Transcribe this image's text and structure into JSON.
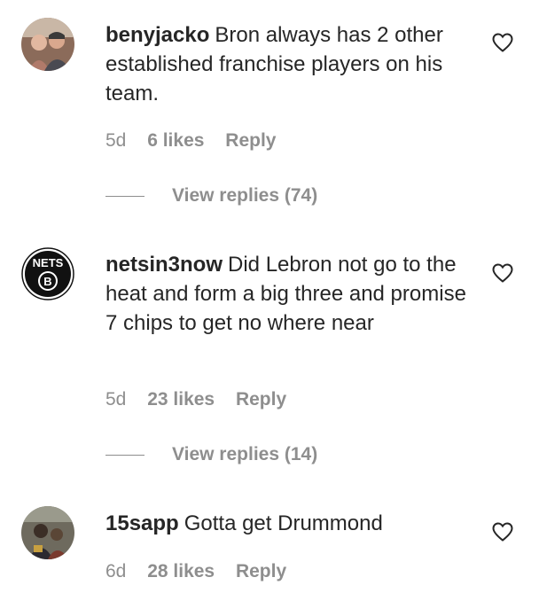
{
  "comments": [
    {
      "username": "benyjacko",
      "text": "Bron always has 2 other established franchise players on his team.",
      "age": "5d",
      "likes": "6 likes",
      "reply": "Reply",
      "view_replies": "View replies (74)"
    },
    {
      "username": "netsin3now",
      "text": "Did Lebron not go to the heat and form a big three and promise 7 chips to get no where near",
      "age": "5d",
      "likes": "23 likes",
      "reply": "Reply",
      "view_replies": "View replies (14)",
      "avatar_logo_text": "NETS"
    },
    {
      "username": "15sapp",
      "text": "Gotta get Drummond",
      "age": "6d",
      "likes": "28 likes",
      "reply": "Reply"
    }
  ],
  "colors": {
    "text": "#262626",
    "secondary": "#8e8e8e"
  },
  "icons": {
    "like": "heart-outline-icon"
  }
}
